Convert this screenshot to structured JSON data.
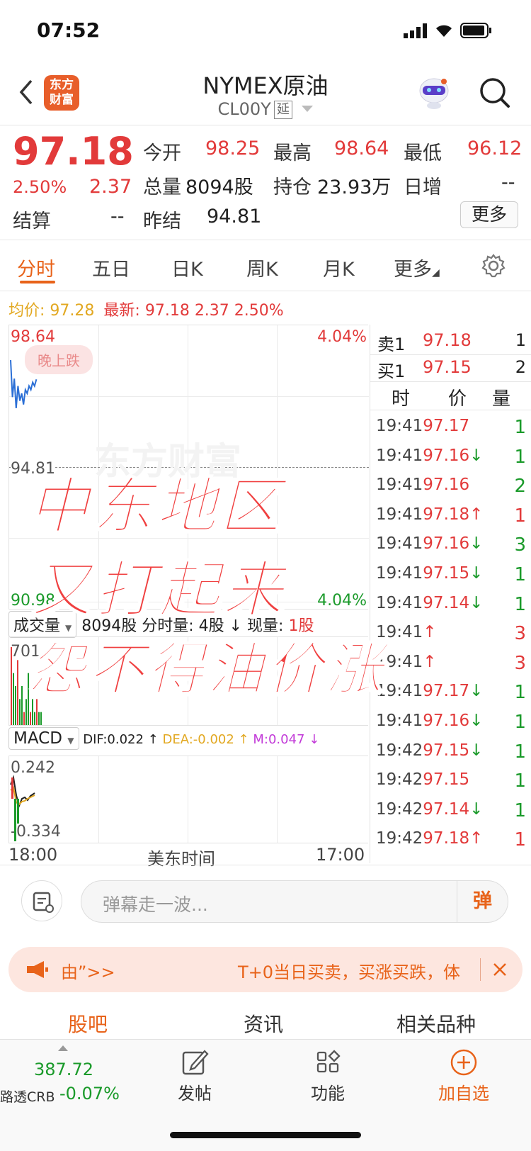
{
  "status": {
    "time": "07:52"
  },
  "header": {
    "title": "NYMEX原油",
    "code": "CL00Y",
    "tag": "延",
    "logo_top": "东方",
    "logo_bottom": "财富"
  },
  "quote": {
    "price": "97.18",
    "pct": "2.50%",
    "chg": "2.37",
    "open_label": "今开",
    "open": "98.25",
    "high_label": "最高",
    "high": "98.64",
    "low_label": "最低",
    "low": "96.12",
    "volume_label": "总量",
    "volume": "8094股",
    "oi_label": "持仓",
    "oi": "23.93万",
    "daily_inc_label": "日增",
    "daily_inc": "--",
    "settle_label": "结算",
    "settle": "--",
    "prev_settle_label": "昨结",
    "prev_settle": "94.81",
    "more_label": "更多"
  },
  "tabs": [
    {
      "label": "分时"
    },
    {
      "label": "五日"
    },
    {
      "label": "日K"
    },
    {
      "label": "周K"
    },
    {
      "label": "月K"
    },
    {
      "label": "更多"
    }
  ],
  "info_line": {
    "avg_label": "均价:",
    "avg": "97.28",
    "last_label": "最新:",
    "last": "97.18",
    "chg": "2.37",
    "pct": "2.50%"
  },
  "chart": {
    "y_top": "98.64",
    "y_mid": "94.81",
    "y_bottom": "90.98",
    "pct_top": "4.04%",
    "pct_bottom": "4.04%",
    "badge": "晚上跌",
    "watermark": "东方财富",
    "vol_label": "成交量",
    "vol_info": "8094股 分时量: 4股 ↓ 现量:",
    "vol_now": "1股",
    "vol_axis": "701",
    "macd_label": "MACD",
    "dif": "DIF:0.022 ↑",
    "dea": "DEA:-0.002 ↑",
    "m": "M:0.047 ↓",
    "macd_top": "0.242",
    "macd_bottom": "-0.334",
    "x_start": "18:00",
    "x_mid": "美东时间",
    "x_end": "17:00",
    "price_line": [
      97.7,
      96.7,
      97.2,
      96.4,
      97.0,
      96.6,
      96.8,
      96.5,
      96.9,
      96.8,
      97.0,
      96.9,
      97.1,
      97.0,
      97.18
    ],
    "volume_bars": [
      6,
      4,
      3,
      5,
      2,
      3,
      1,
      2,
      4,
      1,
      2,
      1,
      2,
      1,
      1
    ]
  },
  "orderbook": {
    "ask": {
      "label": "卖1",
      "price": "97.18",
      "qty": "1"
    },
    "bid": {
      "label": "买1",
      "price": "97.15",
      "qty": "2"
    },
    "head": {
      "time": "时",
      "price": "价",
      "qty": "量"
    },
    "trades": [
      {
        "time": "19:41",
        "price": "97.17",
        "arrow": "",
        "qty": "1"
      },
      {
        "time": "19:41",
        "price": "97.16",
        "arrow": "↓",
        "qty": "1"
      },
      {
        "time": "19:41",
        "price": "97.16",
        "arrow": "",
        "qty": "2"
      },
      {
        "time": "19:41",
        "price": "97.18",
        "arrow": "↑",
        "qty": "1"
      },
      {
        "time": "19:41",
        "price": "97.16",
        "arrow": "↓",
        "qty": "3"
      },
      {
        "time": "19:41",
        "price": "97.15",
        "arrow": "↓",
        "qty": "1"
      },
      {
        "time": "19:41",
        "price": "97.14",
        "arrow": "↓",
        "qty": "1"
      },
      {
        "time": "19:41",
        "price": "",
        "arrow": "↑",
        "qty": "3"
      },
      {
        "time": "19:41",
        "price": "",
        "arrow": "↑",
        "qty": "3"
      },
      {
        "time": "19:41",
        "price": "97.17",
        "arrow": "↓",
        "qty": "1"
      },
      {
        "time": "19:41",
        "price": "97.16",
        "arrow": "↓",
        "qty": "1"
      },
      {
        "time": "19:42",
        "price": "97.15",
        "arrow": "↓",
        "qty": "1"
      },
      {
        "time": "19:42",
        "price": "97.15",
        "arrow": "",
        "qty": "1"
      },
      {
        "time": "19:42",
        "price": "97.14",
        "arrow": "↓",
        "qty": "1"
      },
      {
        "time": "19:42",
        "price": "97.18",
        "arrow": "↑",
        "qty": "1"
      }
    ]
  },
  "overlay": {
    "line1": "中东地区",
    "line2": "又打起来",
    "line3": "怨不得油价涨"
  },
  "comment": {
    "placeholder": "弹幕走一波...",
    "danmu_btn": "弹"
  },
  "promo": {
    "left": "由”>>",
    "right": "T+0当日买卖，买涨买跌，体"
  },
  "section_tabs": [
    {
      "label": "股吧"
    },
    {
      "label": "资讯"
    },
    {
      "label": "相关品种"
    }
  ],
  "bottom": {
    "index_value": "387.72",
    "index_name": "路透CRB",
    "index_change": "-0.07%",
    "post_label": "发帖",
    "func_label": "功能",
    "add_label": "加自选"
  },
  "colors": {
    "up": "#e23a3a",
    "down": "#1a9a2a",
    "accent": "#e8631a",
    "avg": "#e2a821"
  }
}
